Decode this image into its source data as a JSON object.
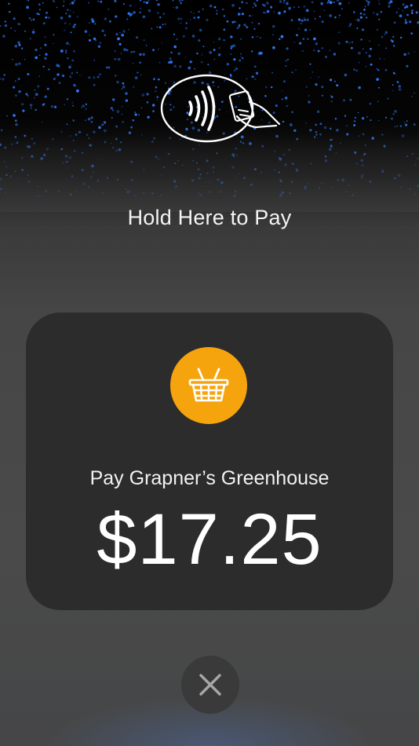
{
  "screen": {
    "prompt": "Hold Here to Pay",
    "nfc_icon": "contactless-tap-icon"
  },
  "payment": {
    "merchant_line": "Pay Grapner’s Greenhouse",
    "amount": "$17.25",
    "merchant_icon": "shopping-basket-icon",
    "merchant_icon_color": "#f6a40e"
  },
  "actions": {
    "close_icon": "close-icon"
  },
  "colors": {
    "sparkle": "#2f7cff",
    "card_background": "#2c2c2c",
    "close_background": "#3a3a3b"
  }
}
